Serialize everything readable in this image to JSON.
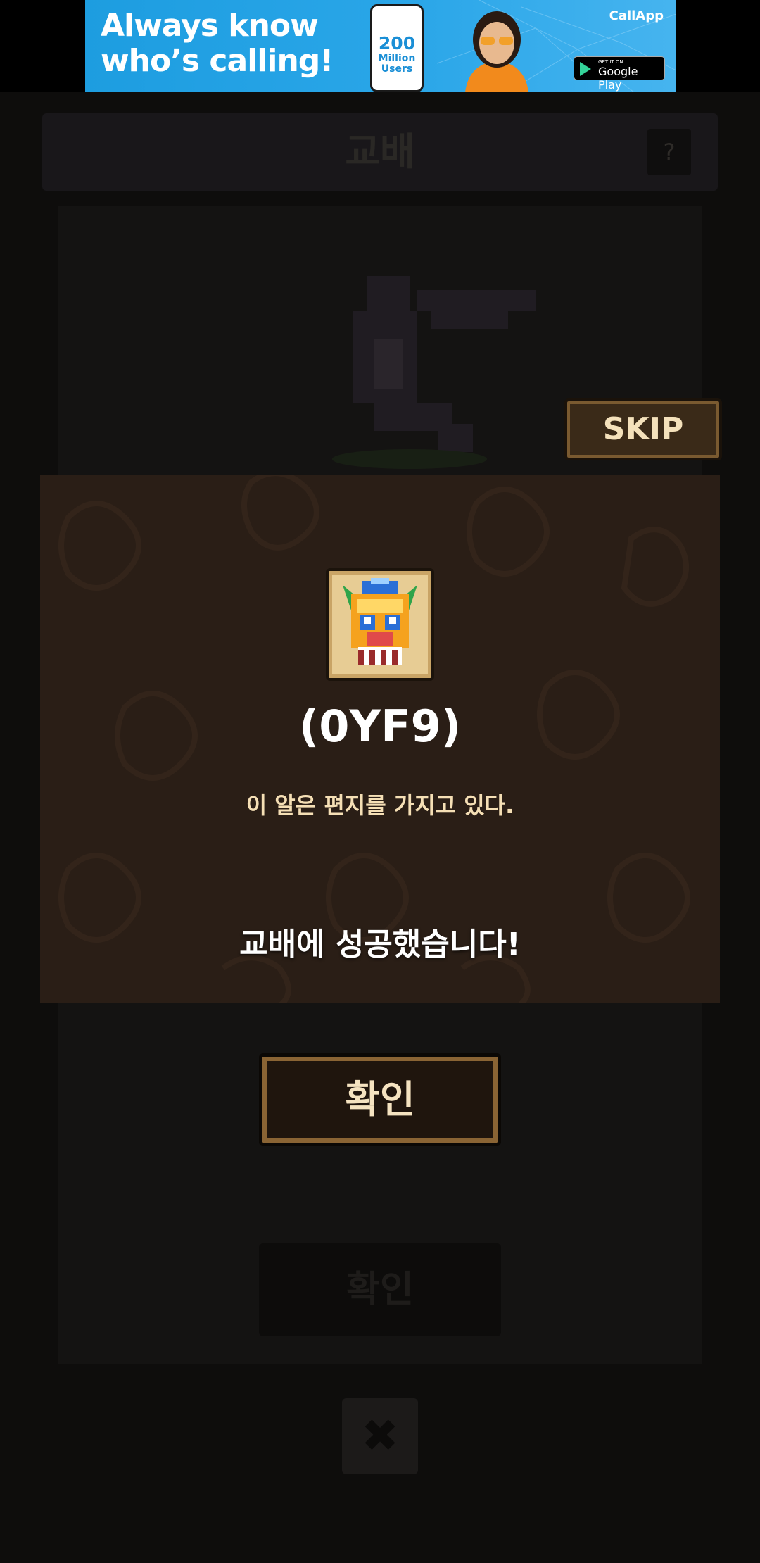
{
  "ad": {
    "headline_line1": "Always know",
    "headline_line2": "who’s calling!",
    "stat_number": "200",
    "stat_line1": "Million",
    "stat_line2": "Users",
    "brand": "CallApp",
    "store_small": "GET IT ON",
    "store_big": "Google Play"
  },
  "background": {
    "title": "교배",
    "help_label": "?",
    "confirm_label": "확인",
    "close_symbol": "✖"
  },
  "skip_label": "SKIP",
  "modal": {
    "item_code": "(0YF9)",
    "item_description": "이 알은 편지를 가지고 있다.",
    "result_message": "교배에 성공했습니다!"
  },
  "confirm_label": "확인",
  "colors": {
    "modal_bg": "#2a1e16",
    "button_border": "#8a6434",
    "button_text": "#f5e3c0",
    "ad_blue": "#2aa6e8"
  }
}
